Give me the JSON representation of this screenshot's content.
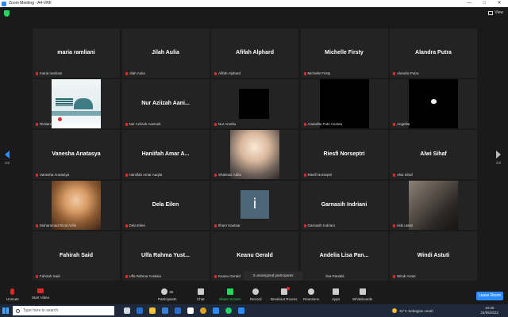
{
  "window": {
    "title": "Zoom Meeting - A4-VRII",
    "minimize": "—",
    "maximize": "□",
    "close": "✕"
  },
  "top": {
    "view_label": "View"
  },
  "pagination": {
    "left": "2/2",
    "right": "2/2"
  },
  "tiles": [
    {
      "center": "maria ramliani",
      "label": "maria ramliani"
    },
    {
      "center": "Jilah Aulia",
      "label": "Jilah Aulia"
    },
    {
      "center": "Afifah Alphard",
      "label": "Afifah Alphard"
    },
    {
      "center": "Michelle Firsty",
      "label": "Michelle Firsty"
    },
    {
      "center": "Alandra Putra",
      "label": "Alandra Putra"
    },
    {
      "center": "",
      "label": "Ristiani"
    },
    {
      "center": "Nur Aziizah Aani...",
      "label": "Nur Aziizah Aanisah"
    },
    {
      "center": "",
      "label": "Nur Amelia"
    },
    {
      "center": "",
      "label": "Anandita Putri Ananta"
    },
    {
      "center": "",
      "label": "Angelita"
    },
    {
      "center": "Vanesha Anatasya",
      "label": "Vanesha Anatasya"
    },
    {
      "center": "Haniifah Amar A...",
      "label": "Haniifah Amar Aaqila"
    },
    {
      "center": "",
      "label": "Shahnaz Adila"
    },
    {
      "center": "Riesfi Norseptri",
      "label": "Riesfi Norseptri"
    },
    {
      "center": "Alwi Sihaf",
      "label": "Alwi Sihaf"
    },
    {
      "center": "",
      "label": "Muhammad Rizal Arifin"
    },
    {
      "center": "Dela Eilen",
      "label": "Dela Eilen"
    },
    {
      "center": "",
      "label": "Ilham Kautsar",
      "avatar": "i"
    },
    {
      "center": "Garnasih Indriani",
      "label": "Garnasih Indriani"
    },
    {
      "center": "",
      "label": "riski utami"
    },
    {
      "center": "Fahirah Said",
      "label": "Fahirah Said"
    },
    {
      "center": "Ulfa Rahma Yust...",
      "label": "Ulfa Rahma Yustisia"
    },
    {
      "center": "Keanu Gerald",
      "label": "Keanu Gerald"
    },
    {
      "center": "Andelia Lisa Pan...",
      "label": "lisa Pandeli"
    },
    {
      "center": "Windi Astuti",
      "label": "Windi Astuti"
    }
  ],
  "unassigned": "3 unassigned participants",
  "toolbar": {
    "unmute": "Unmute",
    "start_video": "Start Video",
    "participants": "Participants",
    "participants_count": "36",
    "chat": "Chat",
    "share": "Share Screen",
    "record": "Record",
    "breakout": "Breakout Rooms",
    "reactions": "Reactions",
    "apps": "Apps",
    "whiteboards": "Whiteboards",
    "leave": "Leave Room"
  },
  "taskbar": {
    "search_placeholder": "Type here to search",
    "weather": "31°C  Sebagian cerah",
    "time": "10:30",
    "date": "24/05/2022"
  },
  "colors": {
    "accent": "#2d8cff",
    "muted": "#e02828",
    "share": "#23d959"
  }
}
